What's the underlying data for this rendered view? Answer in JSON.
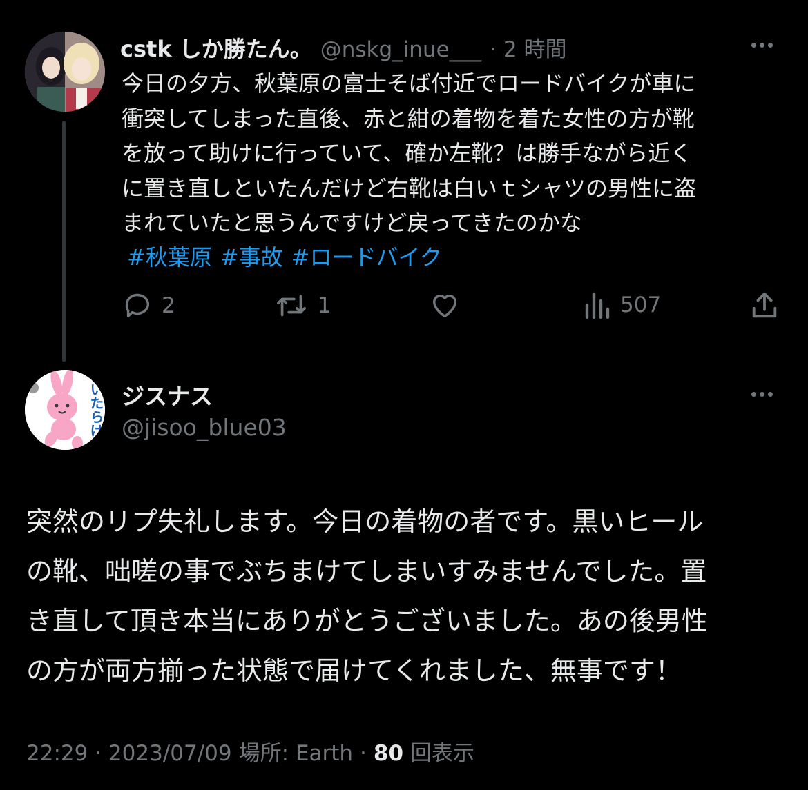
{
  "first_tweet": {
    "display_name": "cstk しか勝たん。",
    "handle": "@nskg_inue___",
    "time": "· 2 時間",
    "text_lines": [
      "今日の夕方、秋葉原の富士そば付近でロードバイクが車に",
      "衝突してしまった直後、赤と紺の着物を着た女性の方が靴",
      "を放って助けに行っていて、確か左靴？は勝手ながら近く",
      "に置き直しといたんだけど右靴は白いｔシャツの男性に盗",
      "まれていたと思うんですけど戻ってきたのかな"
    ],
    "hashtags": [
      "#秋葉原",
      "#事故",
      "#ロードバイク"
    ],
    "actions": {
      "replies": "2",
      "retweets": "1",
      "views": "507"
    }
  },
  "second_tweet": {
    "display_name": "ジスナス",
    "handle": "@jisoo_blue03",
    "avatar_text": "いたらけ",
    "text_lines": [
      "突然のリプ失礼します。今日の着物の者です。黒いヒール",
      "の靴、咄嗟の事でぶちまけてしまいすみませんでした。置",
      "き直して頂き本当にありがとうございました。あの後男性",
      "の方が両方揃った状態で届けてくれました、無事です！"
    ],
    "timestamp": "22:29 · 2023/07/09",
    "location_label": "場所: Earth",
    "separator": "·",
    "view_count": "80",
    "view_label": "回表示"
  },
  "icons": [
    "reply-icon",
    "retweet-icon",
    "like-icon",
    "views-icon",
    "share-icon",
    "more-icon"
  ],
  "colors": {
    "background": "#000000",
    "text": "#e7e9ea",
    "muted": "#71767b",
    "link": "#1d9bf0",
    "thread_line": "#333639"
  }
}
